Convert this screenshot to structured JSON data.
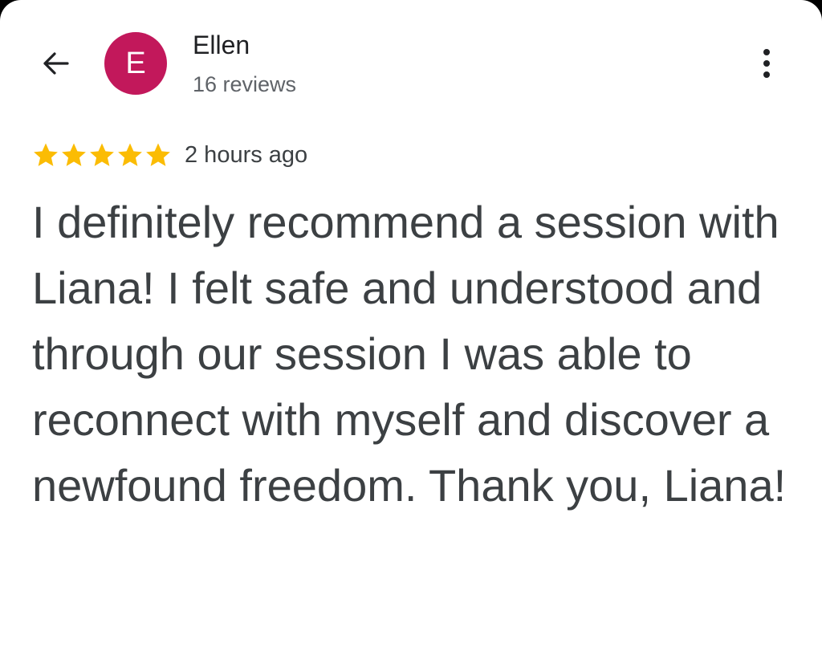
{
  "header": {
    "back_icon": "arrow-left-icon",
    "reviewer": {
      "initial": "E",
      "avatar_color": "#c2185b",
      "name": "Ellen",
      "review_count": "16 reviews"
    },
    "more_icon": "more-vert-icon"
  },
  "review": {
    "rating": 5,
    "rating_max": 5,
    "star_color": "#fbbc04",
    "time": "2 hours ago",
    "text": "I definitely recommend a session with Liana! I felt safe and understood and through our session I was able to reconnect with myself and discover a newfound freedom. Thank you, Liana!"
  }
}
